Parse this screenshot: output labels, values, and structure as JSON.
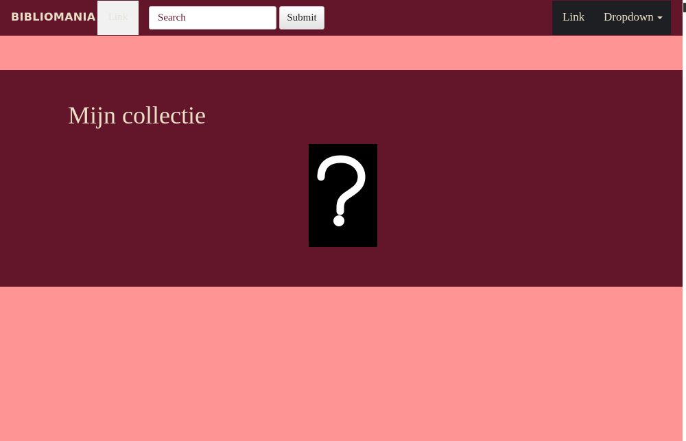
{
  "navbar": {
    "brand": "BIBLIOMANIA",
    "active_link": "Link",
    "search": {
      "placeholder": "Search",
      "value": ""
    },
    "submit_label": "Submit",
    "right_link": "Link",
    "dropdown_label": "Dropdown",
    "dropdown_icon": "caret-down-icon"
  },
  "main": {
    "title": "Mijn collectie",
    "cover_icon": "question-mark-icon"
  },
  "colors": {
    "navbar_bg": "#63152a",
    "page_bg": "#ff9494",
    "text_light": "#eadfc6",
    "right_nav_bg": "#1e1f22",
    "cover_bg": "#000000"
  }
}
